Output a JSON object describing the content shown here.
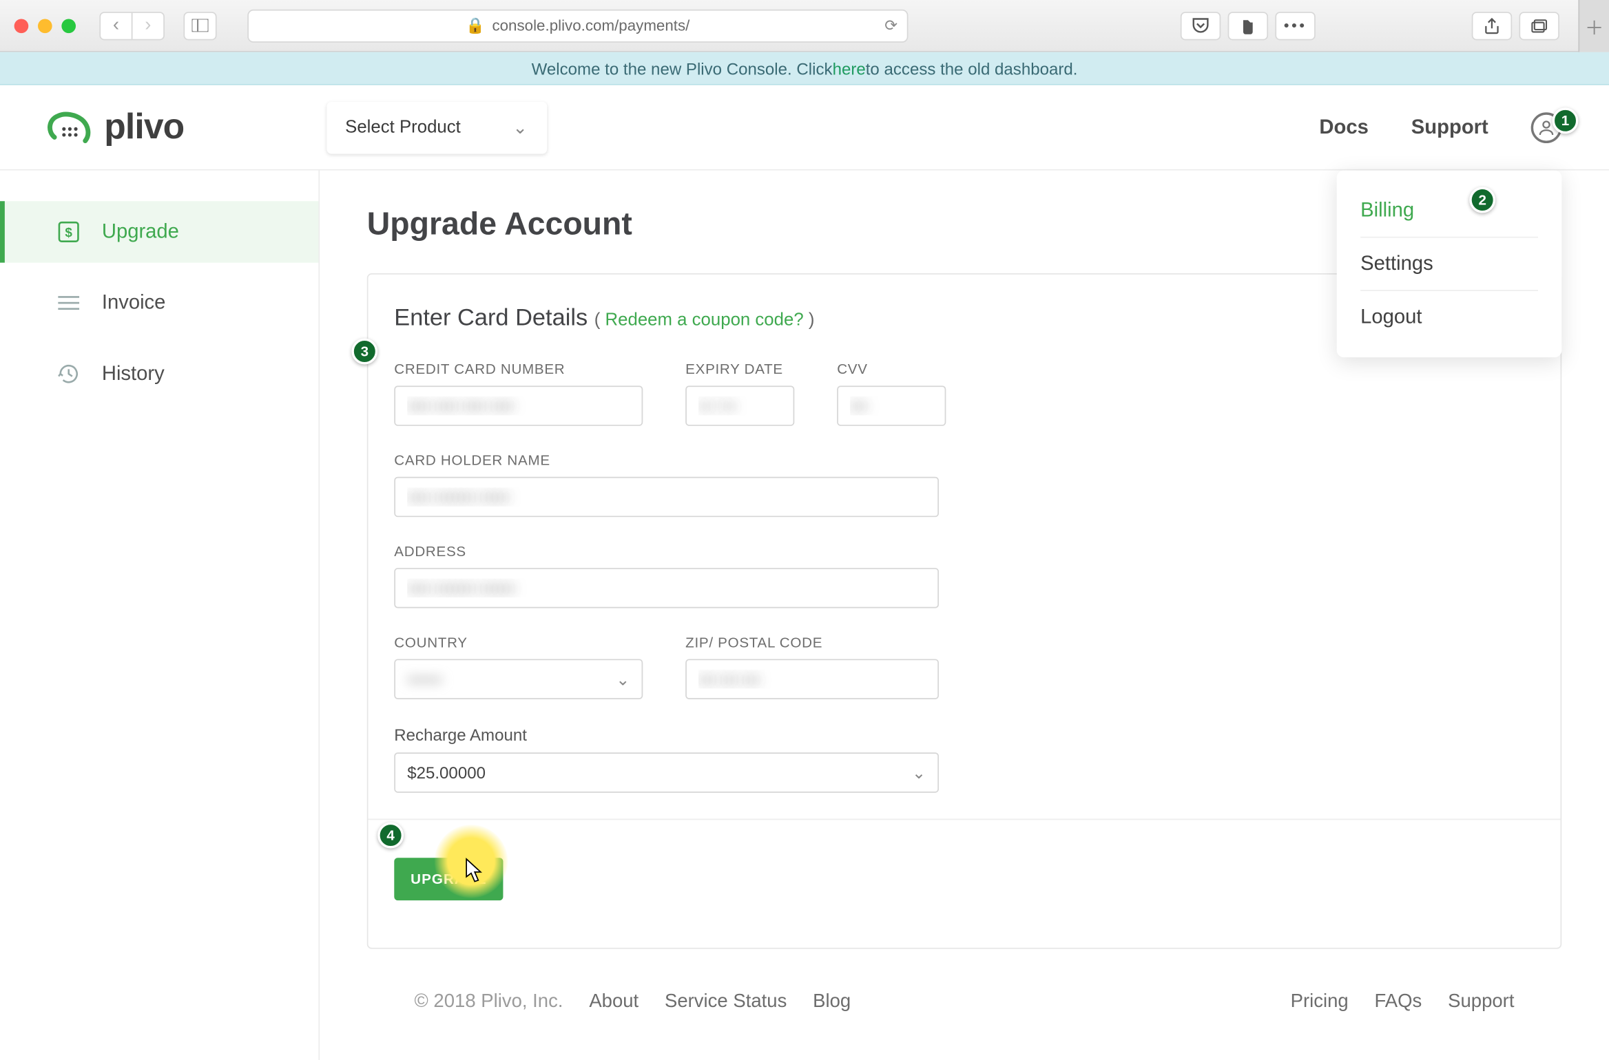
{
  "browser": {
    "url": "console.plivo.com/payments/"
  },
  "banner": {
    "prefix": "Welcome to the new Plivo Console. Click ",
    "link": "here",
    "suffix": " to access the old dashboard."
  },
  "header": {
    "brand": "plivo",
    "product_select_label": "Select Product",
    "nav": {
      "docs": "Docs",
      "support": "Support"
    },
    "user_menu": {
      "billing": "Billing",
      "settings": "Settings",
      "logout": "Logout"
    }
  },
  "sidebar": {
    "items": [
      {
        "label": "Upgrade"
      },
      {
        "label": "Invoice"
      },
      {
        "label": "History"
      }
    ]
  },
  "page": {
    "title": "Upgrade Account",
    "card_title": "Enter Card Details",
    "coupon_prefix": "( ",
    "coupon_link": "Redeem a coupon code?",
    "coupon_suffix": " )",
    "labels": {
      "cc": "CREDIT CARD NUMBER",
      "expiry": "EXPIRY DATE",
      "cvv": "CVV",
      "holder": "CARD HOLDER NAME",
      "address": "ADDRESS",
      "country": "COUNTRY",
      "zip": "ZIP/ POSTAL CODE",
      "recharge": "Recharge Amount"
    },
    "recharge_value": "$25.00000",
    "submit": "UPGRADE"
  },
  "steps": {
    "avatar": "1",
    "billing": "2",
    "form": "3",
    "button": "4"
  },
  "footer": {
    "copyright": "© 2018 Plivo, Inc.",
    "left": {
      "about": "About",
      "status": "Service Status",
      "blog": "Blog"
    },
    "right": {
      "pricing": "Pricing",
      "faqs": "FAQs",
      "support": "Support"
    }
  }
}
